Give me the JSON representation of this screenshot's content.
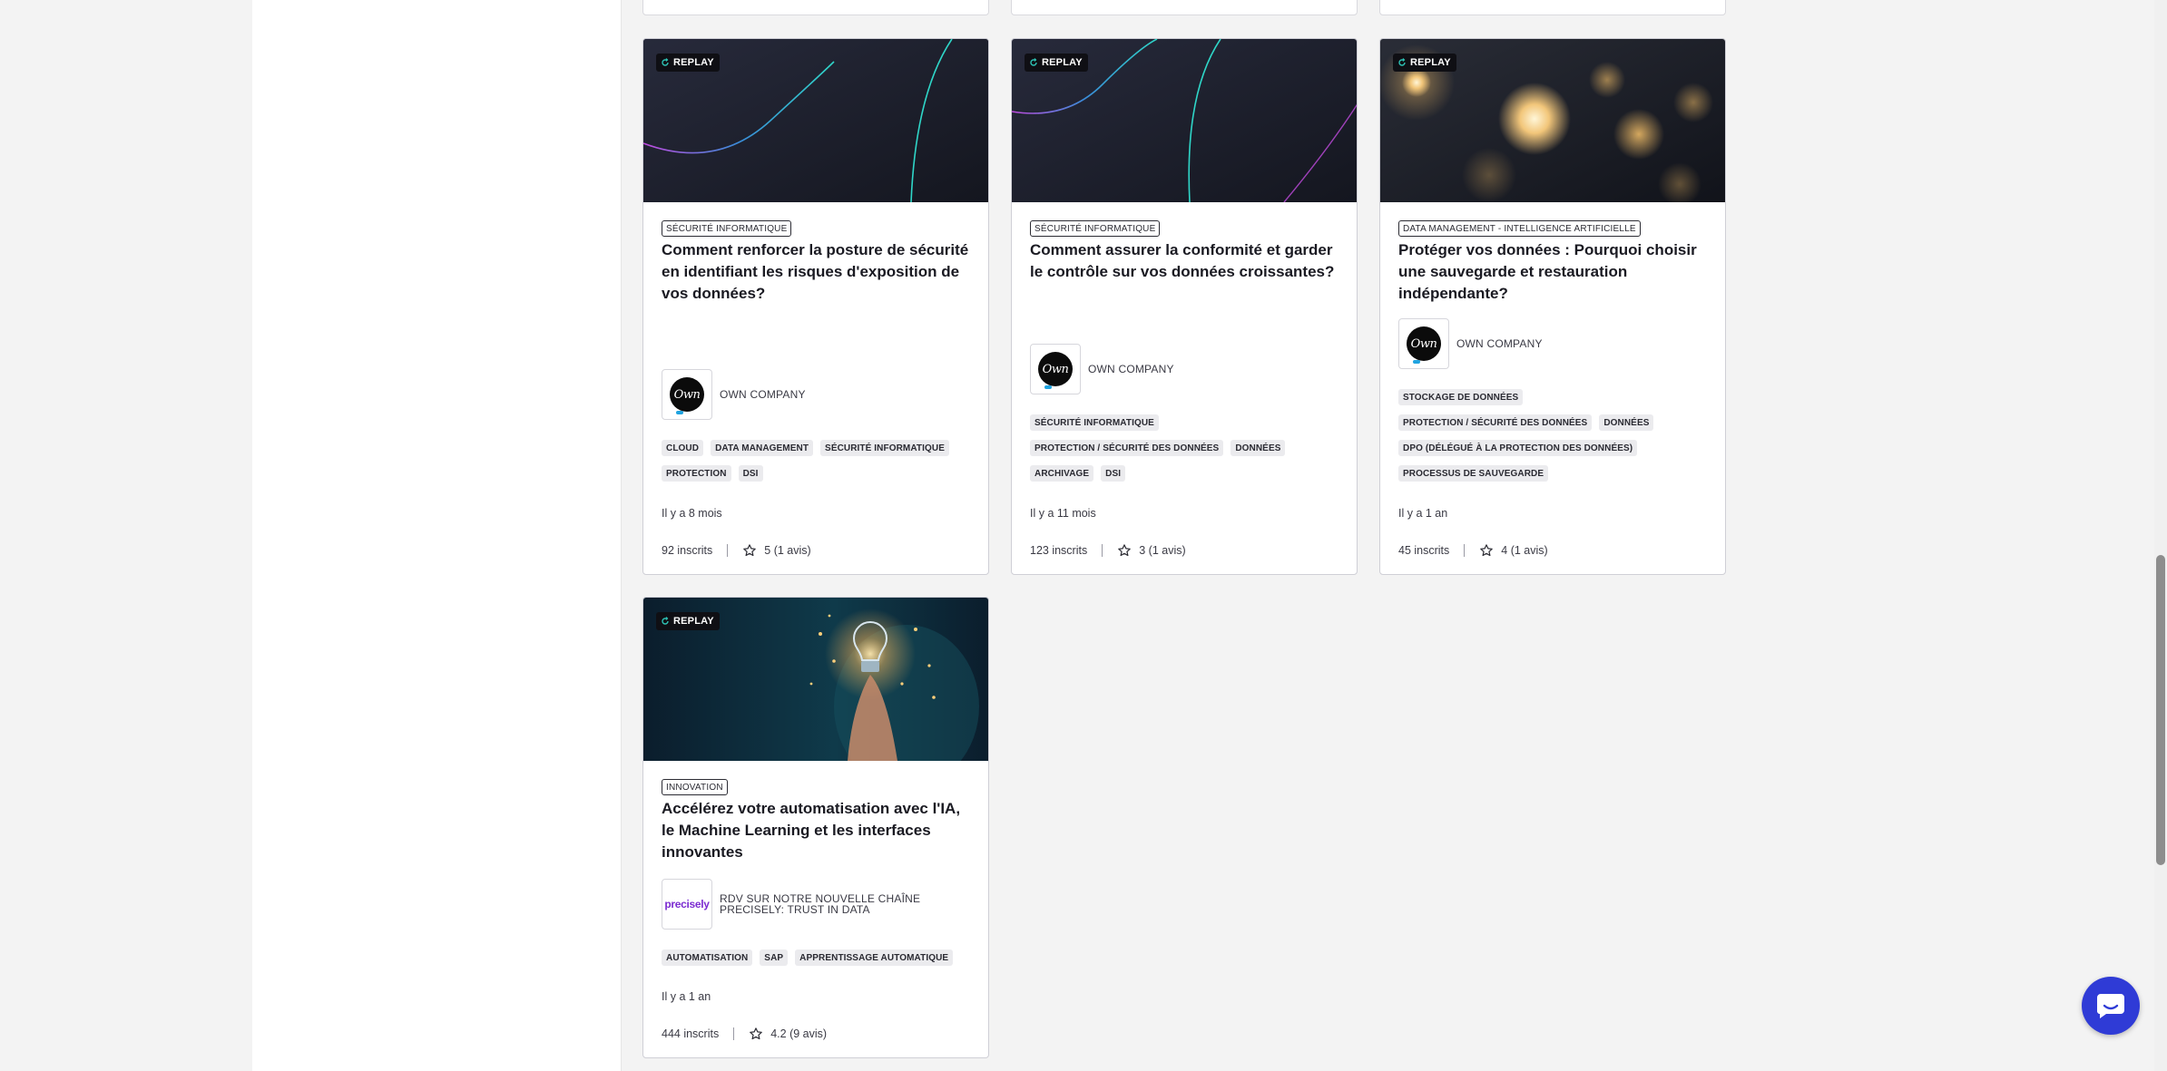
{
  "cards": [
    {
      "badge": "REPLAY",
      "category": "SÉCURITÉ INFORMATIQUE",
      "title": "Comment renforcer la posture de sécurité en identifiant les risques d'exposition de vos données?",
      "org_name": "OWN COMPANY",
      "logo": "own-logo",
      "tags": [
        "CLOUD",
        "DATA MANAGEMENT",
        "SÉCURITÉ INFORMATIQUE",
        "PROTECTION",
        "DSI"
      ],
      "date": "Il y a 8 mois",
      "registrations": "92 inscrits",
      "rating": "5 (1 avis)"
    },
    {
      "badge": "REPLAY",
      "category": "SÉCURITÉ INFORMATIQUE",
      "title": "Comment assurer la conformité et garder le contrôle sur vos données croissantes?",
      "org_name": "OWN COMPANY",
      "logo": "own-logo",
      "tags": [
        "SÉCURITÉ INFORMATIQUE",
        "PROTECTION / SÉCURITÉ DES DONNÉES",
        "DONNÉES",
        "ARCHIVAGE",
        "DSI"
      ],
      "date": "Il y a 11 mois",
      "registrations": "123 inscrits",
      "rating": "3 (1 avis)"
    },
    {
      "badge": "REPLAY",
      "category": "DATA MANAGEMENT - INTELLIGENCE ARTIFICIELLE",
      "title": "Protéger vos données : Pourquoi choisir une sauvegarde et restauration indépendante?",
      "org_name": "OWN COMPANY",
      "logo": "own-logo",
      "tags": [
        "STOCKAGE DE DONNÉES",
        "PROTECTION / SÉCURITÉ DES DONNÉES",
        "DONNÉES",
        "DPO (DÉLÉGUÉ À LA PROTECTION DES DONNÉES)",
        "PROCESSUS DE SAUVEGARDE"
      ],
      "date": "Il y a 1 an",
      "registrations": "45 inscrits",
      "rating": "4 (1 avis)"
    },
    {
      "badge": "REPLAY",
      "category": "INNOVATION",
      "title": "Accélérez votre automatisation avec l'IA, le Machine Learning et les interfaces innovantes",
      "org_name": "RDV SUR NOTRE NOUVELLE CHAÎNE PRECISELY: TRUST IN DATA",
      "logo": "precisely-logo",
      "logo_text": "precisely",
      "tags": [
        "AUTOMATISATION",
        "SAP",
        "APPRENTISSAGE AUTOMATIQUE"
      ],
      "date": "Il y a 1 an",
      "registrations": "444 inscrits",
      "rating": "4.2 (9 avis)"
    }
  ],
  "own_logo_text": "Own",
  "colors": {
    "accent": "#2f3bd6",
    "replay_icon": "#2ec4b6",
    "thumb_dark": "#1c1f2e"
  }
}
